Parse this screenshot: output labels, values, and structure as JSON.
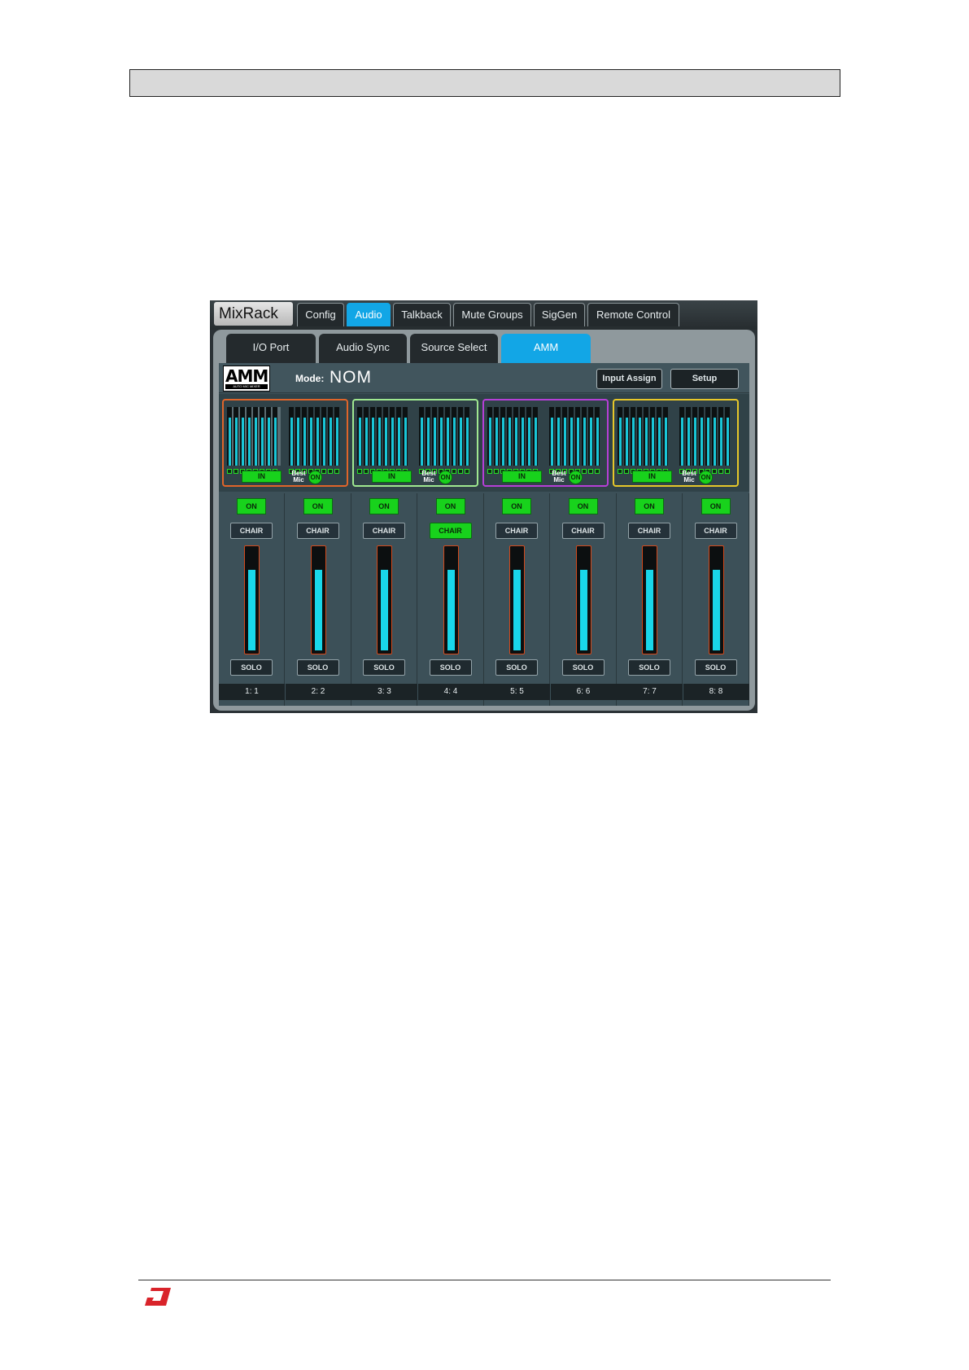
{
  "window": {
    "title": "MixRack",
    "tabs": [
      {
        "label": "Config",
        "active": false
      },
      {
        "label": "Audio",
        "active": true
      },
      {
        "label": "Talkback",
        "active": false
      },
      {
        "label": "Mute Groups",
        "active": false
      },
      {
        "label": "SigGen",
        "active": false
      },
      {
        "label": "Remote Control",
        "active": false
      }
    ]
  },
  "subtabs": [
    {
      "label": "I/O Port",
      "active": false
    },
    {
      "label": "Audio Sync",
      "active": false
    },
    {
      "label": "Source Select",
      "active": false
    },
    {
      "label": "AMM",
      "active": true
    }
  ],
  "amm": {
    "logo_text": "AMM",
    "logo_sub": "AUTO MIC MIXER",
    "mode_label": "Mode:",
    "mode_value": "NOM",
    "input_assign_label": "Input Assign",
    "setup_label": "Setup"
  },
  "groups": [
    {
      "color": "#e0652a",
      "in_label": "IN",
      "best_label_1": "Best",
      "best_label_2": "Mic",
      "on_label": "ON"
    },
    {
      "color": "#9fe890",
      "in_label": "IN",
      "best_label_1": "Best",
      "best_label_2": "Mic",
      "on_label": "ON"
    },
    {
      "color": "#b53fd6",
      "in_label": "IN",
      "best_label_1": "Best",
      "best_label_2": "Mic",
      "on_label": "ON"
    },
    {
      "color": "#e6c72a",
      "in_label": "IN",
      "best_label_1": "Best",
      "best_label_2": "Mic",
      "on_label": "ON"
    }
  ],
  "channels": [
    {
      "on_label": "ON",
      "chair_label": "CHAIR",
      "chair_active": false,
      "solo_label": "SOLO",
      "name": "1: 1",
      "level": 0.75
    },
    {
      "on_label": "ON",
      "chair_label": "CHAIR",
      "chair_active": false,
      "solo_label": "SOLO",
      "name": "2: 2",
      "level": 0.75
    },
    {
      "on_label": "ON",
      "chair_label": "CHAIR",
      "chair_active": false,
      "solo_label": "SOLO",
      "name": "3: 3",
      "level": 0.75
    },
    {
      "on_label": "ON",
      "chair_label": "CHAIR",
      "chair_active": true,
      "solo_label": "SOLO",
      "name": "4: 4",
      "level": 0.75
    },
    {
      "on_label": "ON",
      "chair_label": "CHAIR",
      "chair_active": false,
      "solo_label": "SOLO",
      "name": "5: 5",
      "level": 0.75
    },
    {
      "on_label": "ON",
      "chair_label": "CHAIR",
      "chair_active": false,
      "solo_label": "SOLO",
      "name": "6: 6",
      "level": 0.75
    },
    {
      "on_label": "ON",
      "chair_label": "CHAIR",
      "chair_active": false,
      "solo_label": "SOLO",
      "name": "7: 7",
      "level": 0.75
    },
    {
      "on_label": "ON",
      "chair_label": "CHAIR",
      "chair_active": false,
      "solo_label": "SOLO",
      "name": "8: 8",
      "level": 0.75
    }
  ],
  "colors": {
    "accent": "#12a6e6",
    "green": "#18d21c",
    "meter": "#19c6d7"
  }
}
